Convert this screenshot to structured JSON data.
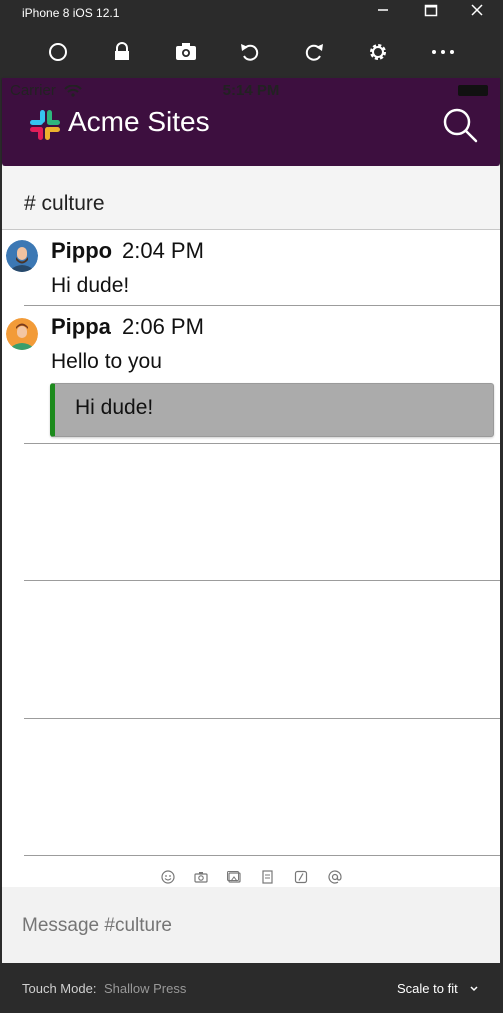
{
  "window": {
    "title": "iPhone 8 iOS 12.1"
  },
  "toolbar": {
    "buttons": [
      "home-icon",
      "lock-icon",
      "screenshot-icon",
      "rotate-left-icon",
      "rotate-right-icon",
      "settings-icon",
      "more-icon"
    ]
  },
  "status_bar": {
    "carrier": "Carrier",
    "time": "5:14 PM"
  },
  "app": {
    "title": "Acme Sites"
  },
  "channel": {
    "name": "# culture"
  },
  "messages": [
    {
      "author": "Pippo",
      "time": "2:04 PM",
      "text": "Hi dude!"
    },
    {
      "author": "Pippa",
      "time": "2:06 PM",
      "text": "Hello to you",
      "quote": "Hi dude!",
      "quote_color": "#1c8a1c"
    }
  ],
  "composer": {
    "placeholder": "Message #culture",
    "icons": [
      "emoji-icon",
      "camera-icon",
      "photo-icon",
      "file-icon",
      "slash-command-icon",
      "mention-icon"
    ]
  },
  "bottom_bar": {
    "touch_mode_label": "Touch Mode:",
    "touch_mode_value": "Shallow Press",
    "scale_label": "Scale to fit"
  },
  "colors": {
    "navbar": "#3d0f3f",
    "chrome": "#2b2b2b",
    "quote_bar": "#1c8a1c"
  }
}
